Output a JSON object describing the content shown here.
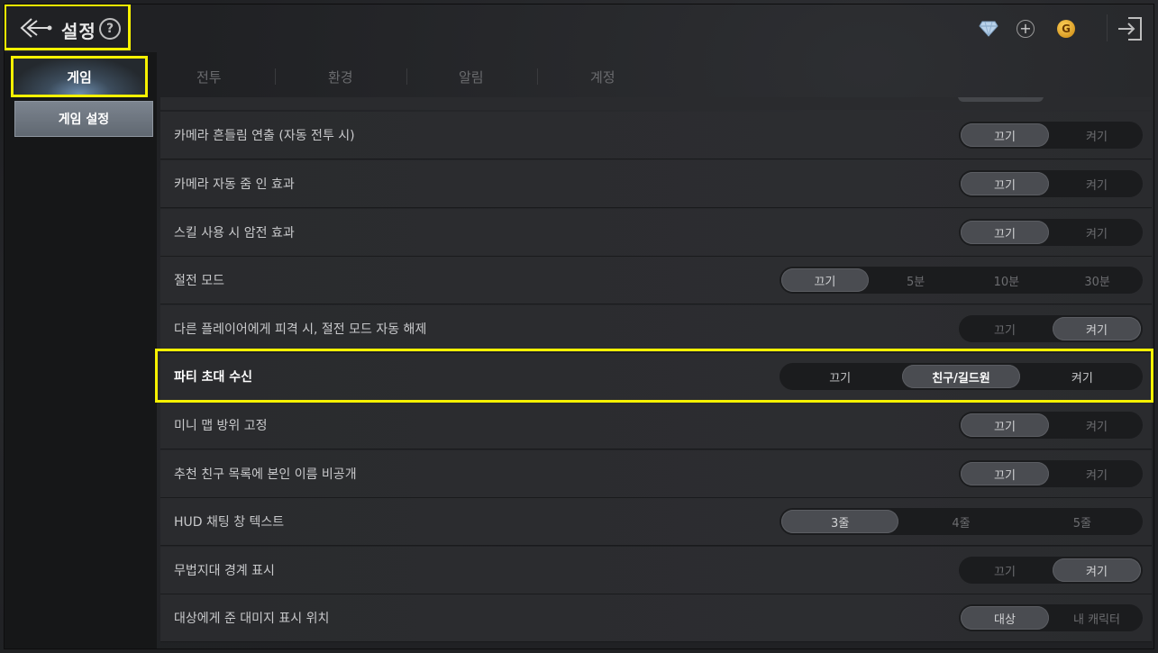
{
  "header": {
    "title": "설정",
    "help_glyph": "?",
    "gold_glyph": "G",
    "plus_glyph": "+"
  },
  "sidebar": {
    "tab_label": "게임",
    "sub_label": "게임 설정"
  },
  "tabs": [
    "전투",
    "환경",
    "알림",
    "계정"
  ],
  "settings": [
    {
      "label": "카메라 흔들림 연출 (자동 전투 시)",
      "options": [
        "끄기",
        "켜기"
      ],
      "selected": 0
    },
    {
      "label": "카메라 자동 줌 인 효과",
      "options": [
        "끄기",
        "켜기"
      ],
      "selected": 0
    },
    {
      "label": "스킬 사용 시 암전 효과",
      "options": [
        "끄기",
        "켜기"
      ],
      "selected": 0
    },
    {
      "label": "절전 모드",
      "options": [
        "끄기",
        "5분",
        "10분",
        "30분"
      ],
      "selected": 0
    },
    {
      "label": "다른 플레이어에게 피격 시, 절전 모드 자동 해제",
      "options": [
        "끄기",
        "켜기"
      ],
      "selected": 1
    },
    {
      "label": "파티 초대 수신",
      "options": [
        "끄기",
        "친구/길드원",
        "켜기"
      ],
      "selected": 1
    },
    {
      "label": "미니 맵 방위 고정",
      "options": [
        "끄기",
        "켜기"
      ],
      "selected": 0
    },
    {
      "label": "추천 친구 목록에 본인 이름 비공개",
      "options": [
        "끄기",
        "켜기"
      ],
      "selected": 0
    },
    {
      "label": "HUD 채팅 창 텍스트",
      "options": [
        "3줄",
        "4줄",
        "5줄"
      ],
      "selected": 0
    },
    {
      "label": "무법지대 경계 표시",
      "options": [
        "끄기",
        "켜기"
      ],
      "selected": 1
    },
    {
      "label": "대상에게 준 대미지 표시 위치",
      "options": [
        "대상",
        "내 캐릭터"
      ],
      "selected": 0
    }
  ],
  "colors": {
    "highlight": "#f6f100",
    "accent_gold": "#e0a021"
  }
}
